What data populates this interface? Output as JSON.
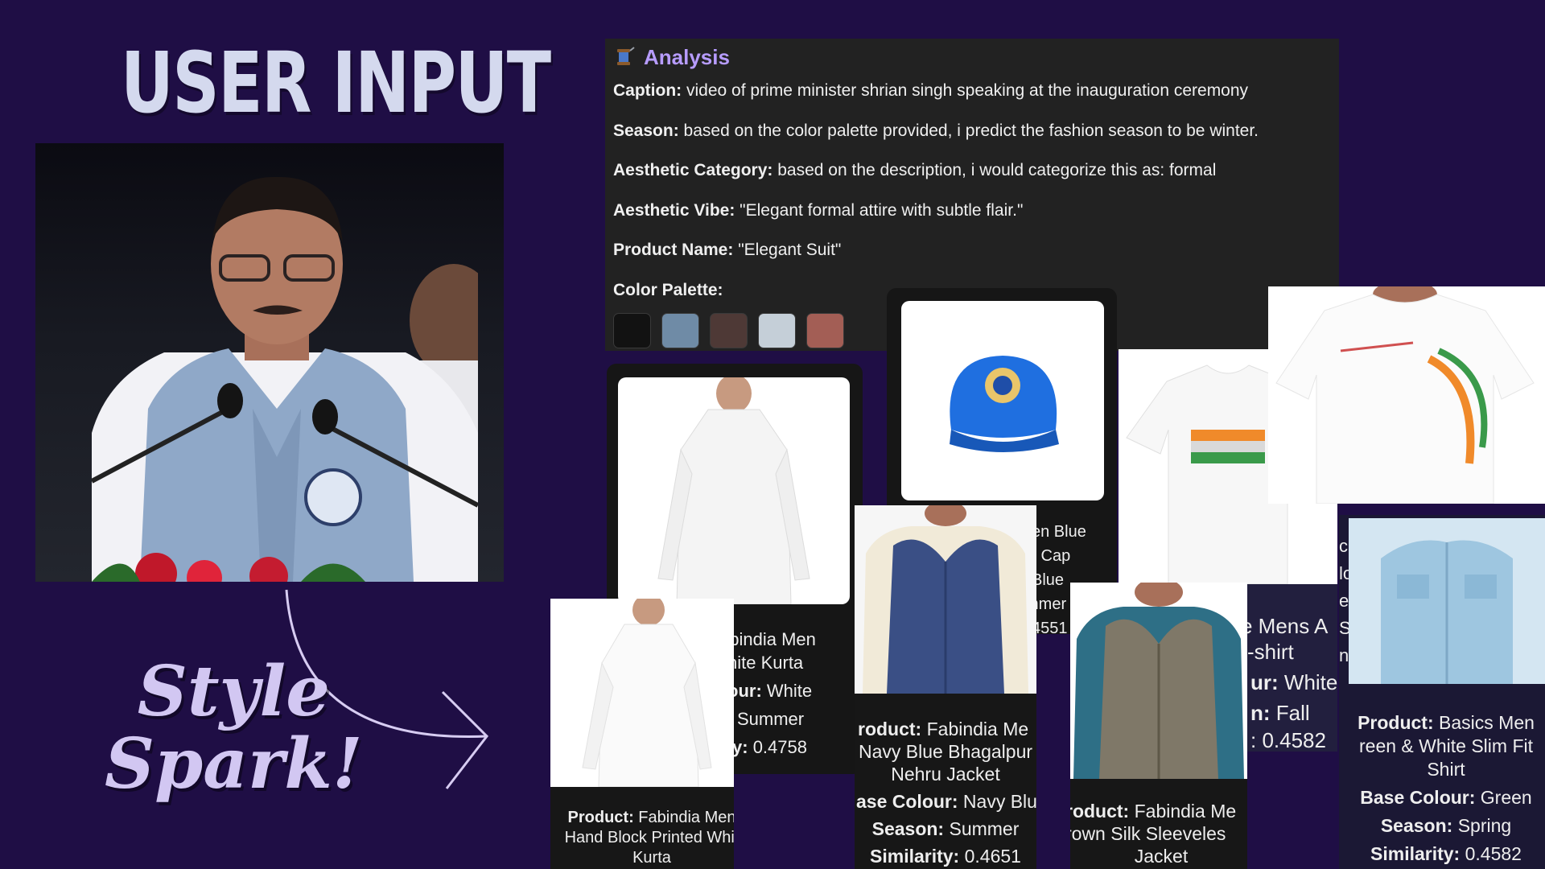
{
  "hero": {
    "title": "USER INPUT",
    "brand_line1": "Style",
    "brand_line2": "Spark!"
  },
  "analysis": {
    "icon": "thread-spool-icon",
    "title": "Analysis",
    "caption_label": "Caption:",
    "caption": "video of prime minister shrian singh speaking at the inauguration ceremony",
    "season_label": "Season:",
    "season": "based on the color palette provided, i predict the fashion season to be winter.",
    "aesthetic_category_label": "Aesthetic Category:",
    "aesthetic_category": "based on the description, i would categorize this as: formal",
    "aesthetic_vibe_label": "Aesthetic Vibe:",
    "aesthetic_vibe": "\"Elegant formal attire with subtle flair.\"",
    "product_name_label": "Product Name:",
    "product_name": "\"Elegant Suit\"",
    "color_palette_label": "Color Palette:",
    "palette": [
      "#121212",
      "#6f8ba6",
      "#4e3936",
      "#c5cfd8",
      "#a35e55"
    ]
  },
  "labels": {
    "product": "Product:",
    "base_colour": "Base Colour:",
    "season": "Season:",
    "similarity": "Similarity:"
  },
  "cards": {
    "kurta_partial": {
      "name_l1": "abindia Men",
      "name_l2": "hite Kurta",
      "colour_label": "our:",
      "colour": "White",
      "season": "Summer",
      "similarity_label": "y:",
      "similarity": "0.4758"
    },
    "cap_partial": {
      "name_l1": "en Blue",
      "name_l2": "y Cap",
      "colour": "Blue",
      "season": "mmer",
      "similarity": "4551"
    },
    "tshirt_partial": {
      "name_l1": "e Mens A",
      "name_l2": "-shirt",
      "colour_label": "ur:",
      "colour": "White",
      "season_label": "n:",
      "season": "Fall",
      "similarity": ": 0.4582"
    },
    "strip": [
      "c",
      "lo",
      "e",
      "S",
      "n"
    ],
    "shirt": {
      "name_l1": "Basics Men",
      "name_l2": "reen & White Slim Fit",
      "name_l3": "Shirt",
      "colour": "Green",
      "season": "Spring",
      "similarity": "0.4582"
    },
    "kurta_full": {
      "name_l1": "Fabindia Men",
      "name_l2": "Hand Block Printed Whit",
      "name_l3": "Kurta"
    },
    "jacket": {
      "product_label": "roduct:",
      "name_l1": "Fabindia Me",
      "name_l2": "Navy Blue Bhagalpur",
      "name_l3": "Nehru Jacket",
      "colour_label": "ase Colour:",
      "colour": "Navy Blu",
      "season": "Summer",
      "similarity": "0.4651"
    },
    "silk_jacket": {
      "product_label": "roduct:",
      "name_l1": "Fabindia Me",
      "name_l2": "rown Silk Sleeveles",
      "name_l3": "Jacket"
    }
  }
}
